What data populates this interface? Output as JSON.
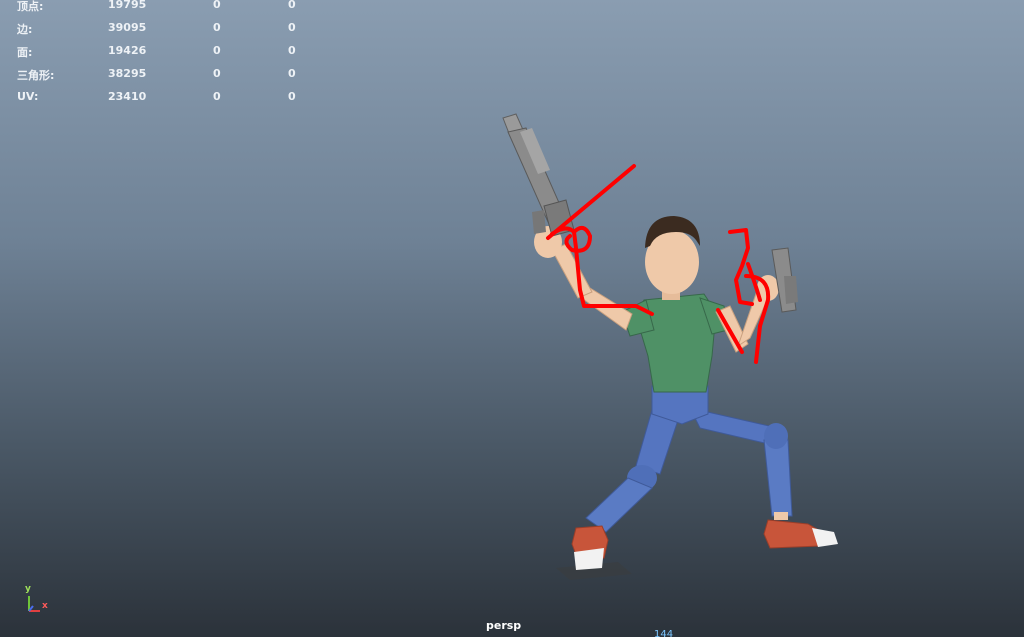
{
  "hud": {
    "rows": [
      {
        "label": "顶点:",
        "v1": "19795",
        "v2": "0",
        "v3": "0"
      },
      {
        "label": "边:",
        "v1": "39095",
        "v2": "0",
        "v3": "0"
      },
      {
        "label": "面:",
        "v1": "19426",
        "v2": "0",
        "v3": "0"
      },
      {
        "label": "三角形:",
        "v1": "38295",
        "v2": "0",
        "v3": "0"
      },
      {
        "label": "UV:",
        "v1": "23410",
        "v2": "0",
        "v3": "0"
      }
    ]
  },
  "viewport": {
    "camera": "persp",
    "frame_readout": "144"
  },
  "axis_gizmo": {
    "y": "y",
    "x": "x"
  },
  "colors": {
    "background_top": "#8a9db1",
    "background_bottom": "#2b323a",
    "hud_text": "#eef2f6",
    "annotation_red": "#ff0000",
    "shirt": "#4f9166",
    "pants": "#5575c0",
    "shoes": "#c8553a",
    "skin": "#efc9a9",
    "hair": "#3b2b20",
    "gun": "#8b8b8b"
  },
  "icons": {
    "axis": "axis-gizmo-icon"
  }
}
